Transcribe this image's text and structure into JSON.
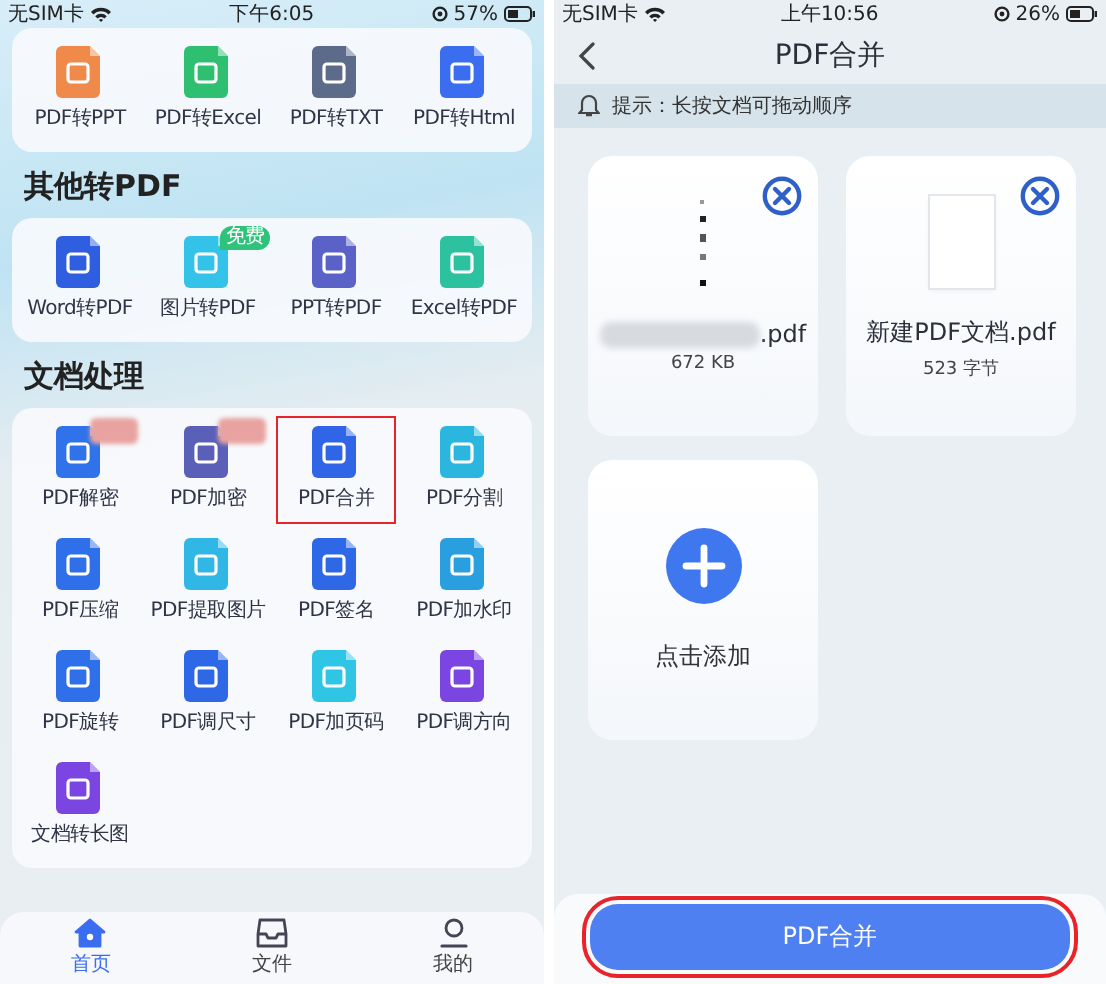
{
  "left_screen": {
    "status_bar": {
      "carrier": "无SIM卡",
      "time": "下午6:05",
      "battery": "57%"
    },
    "sections": [
      {
        "items": [
          {
            "label": "PDF转PPT",
            "color": "#f08a4b",
            "highlighted": false,
            "redacted": false
          },
          {
            "label": "PDF转Excel",
            "color": "#2fbf71",
            "highlighted": false,
            "redacted": false
          },
          {
            "label": "PDF转TXT",
            "color": "#5d6b8a",
            "highlighted": false,
            "redacted": false
          },
          {
            "label": "PDF转Html",
            "color": "#3a6df0",
            "highlighted": false,
            "redacted": false
          }
        ]
      },
      {
        "heading": "其他转PDF",
        "items": [
          {
            "label": "Word转PDF",
            "color": "#2f5fe0",
            "highlighted": false,
            "redacted": false
          },
          {
            "label": "图片转PDF",
            "color": "#33c3e8",
            "badge": "免费",
            "highlighted": false,
            "redacted": false
          },
          {
            "label": "PPT转PDF",
            "color": "#5a62c8",
            "highlighted": false,
            "redacted": false
          },
          {
            "label": "Excel转PDF",
            "color": "#2cc2a0",
            "highlighted": false,
            "redacted": false
          }
        ]
      },
      {
        "heading": "文档处理",
        "items": [
          {
            "label": "PDF解密",
            "color": "#2f72ea",
            "highlighted": false,
            "redacted": true
          },
          {
            "label": "PDF加密",
            "color": "#5a5fb8",
            "highlighted": false,
            "redacted": true
          },
          {
            "label": "PDF合并",
            "color": "#2f65e6",
            "highlighted": true,
            "redacted": false
          },
          {
            "label": "PDF分割",
            "color": "#2bb6e0",
            "highlighted": false,
            "redacted": false
          },
          {
            "label": "PDF压缩",
            "color": "#2f6fea",
            "highlighted": false,
            "redacted": false
          },
          {
            "label": "PDF提取图片",
            "color": "#30b7e6",
            "highlighted": false,
            "redacted": false
          },
          {
            "label": "PDF签名",
            "color": "#2f68e6",
            "highlighted": false,
            "redacted": false
          },
          {
            "label": "PDF加水印",
            "color": "#2a9fe0",
            "highlighted": false,
            "redacted": false
          },
          {
            "label": "PDF旋转",
            "color": "#2f70ea",
            "highlighted": false,
            "redacted": false
          },
          {
            "label": "PDF调尺寸",
            "color": "#2f68e6",
            "highlighted": false,
            "redacted": false
          },
          {
            "label": "PDF加页码",
            "color": "#2fc6e6",
            "highlighted": false,
            "redacted": false
          },
          {
            "label": "PDF调方向",
            "color": "#7a45e0",
            "highlighted": false,
            "redacted": false
          },
          {
            "label": "文档转长图",
            "color": "#7a45e0",
            "highlighted": false,
            "redacted": false
          }
        ]
      }
    ],
    "tab_bar": [
      {
        "label": "首页",
        "kind": "home",
        "selected": true
      },
      {
        "label": "文件",
        "kind": "inbox",
        "selected": false
      },
      {
        "label": "我的",
        "kind": "person",
        "selected": false
      }
    ]
  },
  "right_screen": {
    "status_bar": {
      "carrier": "无SIM卡",
      "time": "上午10:56",
      "battery": "26%"
    },
    "title": "PDF合并",
    "tip": "提示：长按文档可拖动顺序",
    "files": [
      {
        "name": ".pdf",
        "name_redacted": true,
        "size": "672 KB",
        "kind": "strip"
      },
      {
        "name": "新建PDF文档.pdf",
        "name_redacted": false,
        "size": "523 字节",
        "kind": "page"
      }
    ],
    "add_label": "点击添加",
    "action": {
      "label": "PDF合并",
      "highlighted": true
    }
  }
}
